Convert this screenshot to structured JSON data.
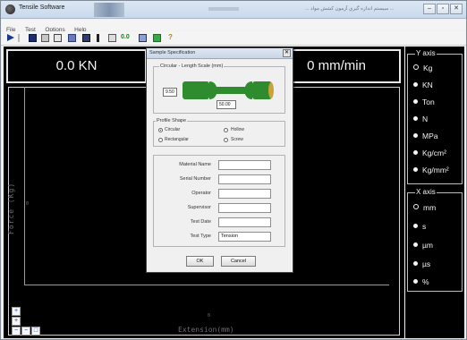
{
  "window": {
    "title": "Tensile Software",
    "title_rtl": "... سيستم اندازه گيري آزمون كشش مواد ..."
  },
  "menu": {
    "items": [
      "File",
      "Test",
      "Options",
      "Help"
    ]
  },
  "toolbar": {
    "speed": "0.0",
    "help": "?"
  },
  "readouts": {
    "force": "0.0 KN",
    "displacement": "0 mm/min"
  },
  "chart": {
    "ylabel": "Force (Kg)",
    "xlabel": "Extension(mm)",
    "y_tick": "0",
    "x_tick": "0"
  },
  "y_axis": {
    "legend": "Y axis",
    "options": [
      "Kg",
      "KN",
      "Ton",
      "N",
      "MPa",
      "Kg/cm²",
      "Kg/mm²"
    ],
    "selected": "Kg"
  },
  "x_axis": {
    "legend": "X axis",
    "options": [
      "mm",
      "s",
      "µm",
      "µs",
      "%"
    ],
    "selected": "mm"
  },
  "dialog": {
    "title": "Sample Specification",
    "length_group": "Circular - Length Scale (mm)",
    "diameter_value": "9.50",
    "length_value": "50.00",
    "profile_group": "Profile Shape",
    "profile_options": [
      "Circular",
      "Hollow",
      "Rectangular",
      "Screw"
    ],
    "profile_selected": "Circular",
    "fields": [
      {
        "label": "Material Name",
        "value": ""
      },
      {
        "label": "Serial Number",
        "value": ""
      },
      {
        "label": "Operator",
        "value": ""
      },
      {
        "label": "Supervisor",
        "value": ""
      },
      {
        "label": "Test Date",
        "value": ""
      },
      {
        "label": "Test Type",
        "value": "Tension"
      }
    ],
    "ok": "OK",
    "cancel": "Cancel"
  },
  "colors": {
    "panel_bg": "#000000",
    "readout_text": "#f4f4f4",
    "specimen": "#2e8b2e"
  }
}
